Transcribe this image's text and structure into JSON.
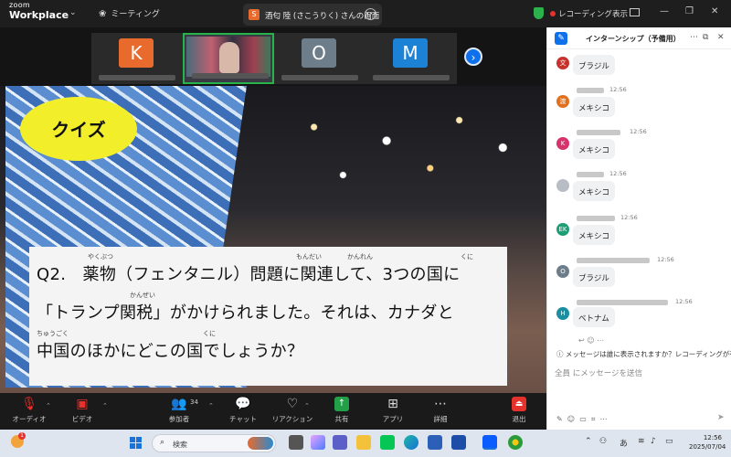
{
  "titlebar": {
    "logo_line1": "zoom",
    "logo_line2": "Workplace",
    "meeting_tab": "ミーティング",
    "share_badge": "S",
    "share_label": "酒匂 陸 (さこうりく) さんの画面",
    "recording": "レコーディング",
    "view": "表示"
  },
  "participants": [
    {
      "initial": "K",
      "color": "#e86a2d"
    },
    {
      "initial": "",
      "color": "",
      "active": true
    },
    {
      "initial": "O",
      "color": "#6d7d8a"
    },
    {
      "initial": "M",
      "color": "#1c82d6"
    }
  ],
  "slide": {
    "badge": "クイズ",
    "line1": "Q2.　薬物（フェンタニル）問題に関連して、3つの国に",
    "line2": "「トランプ関税」がかけられました。それは、カナダと",
    "line3": "中国のほかにどこの国でしょうか？",
    "ruby": {
      "yakubutsu": "やくぶつ",
      "mondai": "もんだい",
      "kanren": "かんれん",
      "kuni1": "くに",
      "kanzei": "かんぜい",
      "chuugoku": "ちゅうごく",
      "kuni2": "くに"
    }
  },
  "toolbar": {
    "audio": "オーディオ",
    "video": "ビデオ",
    "participants": "参加者",
    "participant_count": "34",
    "chat": "チャット",
    "reaction": "リアクション",
    "share": "共有",
    "apps": "アプリ",
    "details": "詳細",
    "leave": "退出"
  },
  "chat": {
    "title": "インターンシップ（予備用）",
    "messages": [
      {
        "avatar": "文",
        "color": "#c8322d",
        "time": "",
        "text": "ブラジル"
      },
      {
        "avatar": "渡",
        "color": "#e0701e",
        "time": "12:56",
        "text": "メキシコ"
      },
      {
        "avatar": "K",
        "color": "#d6336c",
        "time": "12:56",
        "text": "メキシコ"
      },
      {
        "avatar": "",
        "color": "#b8bcc4",
        "time": "12:56",
        "text": "メキシコ"
      },
      {
        "avatar": "EK",
        "color": "#1f9d74",
        "time": "12:56",
        "text": "メキシコ"
      },
      {
        "avatar": "O",
        "color": "#6d7d8a",
        "time": "12:56",
        "text": "ブラジル"
      },
      {
        "avatar": "H",
        "color": "#1a8fa0",
        "time": "12:56",
        "text": "ベトナム"
      }
    ],
    "visibility_note": "メッセージは誰に表示されますか？レコーディングが有効",
    "input_placeholder": "全員 にメッセージを送信"
  },
  "taskbar": {
    "weather_badge": "1",
    "search_placeholder": "検索",
    "ime": "あ",
    "time": "12:56",
    "date": "2025/07/04"
  }
}
